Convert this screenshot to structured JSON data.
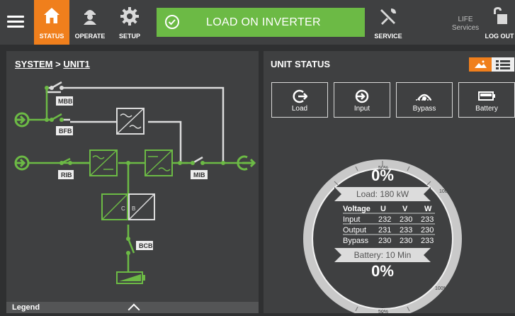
{
  "nav": {
    "status": "STATUS",
    "operate": "OPERATE",
    "setup": "SETUP",
    "service": "SERVICE",
    "life_line1": "LIFE",
    "life_line2": "Services",
    "logout": "LOG OUT"
  },
  "banner": {
    "text": "LOAD ON INVERTER",
    "color": "#6cba45"
  },
  "breadcrumb": {
    "system": "SYSTEM",
    "sep": ">",
    "unit": "UNIT1"
  },
  "diagram": {
    "labels": {
      "mbb": "MBB",
      "bfb": "BFB",
      "rib": "RIB",
      "mib": "MIB",
      "bcb": "BCB",
      "cb": "C",
      "bb": "B"
    },
    "active_color": "#6cba45",
    "inactive_color": "#dcdcdc"
  },
  "legend": {
    "label": "Legend"
  },
  "unit_status": {
    "title": "UNIT STATUS",
    "tiles": [
      {
        "label": "Load",
        "icon": "load-icon"
      },
      {
        "label": "Input",
        "icon": "input-icon"
      },
      {
        "label": "Bypass",
        "icon": "bypass-icon"
      },
      {
        "label": "Battery",
        "icon": "battery-icon"
      }
    ]
  },
  "gauge": {
    "top_percent": "0%",
    "load_label": "Load: 180 kW",
    "table_header": [
      "Voltage",
      "U",
      "V",
      "W"
    ],
    "rows": [
      {
        "name": "Input",
        "u": "232",
        "v": "230",
        "w": "233"
      },
      {
        "name": "Output",
        "u": "231",
        "v": "233",
        "w": "230"
      },
      {
        "name": "Bypass",
        "u": "230",
        "v": "230",
        "w": "233"
      }
    ],
    "battery_label": "Battery: 10 Min",
    "bottom_percent": "0%",
    "scale_50": "50%",
    "scale_100": "100%"
  },
  "colors": {
    "accent": "#f07f1c",
    "ok": "#6cba45",
    "panel": "#3f4041"
  }
}
